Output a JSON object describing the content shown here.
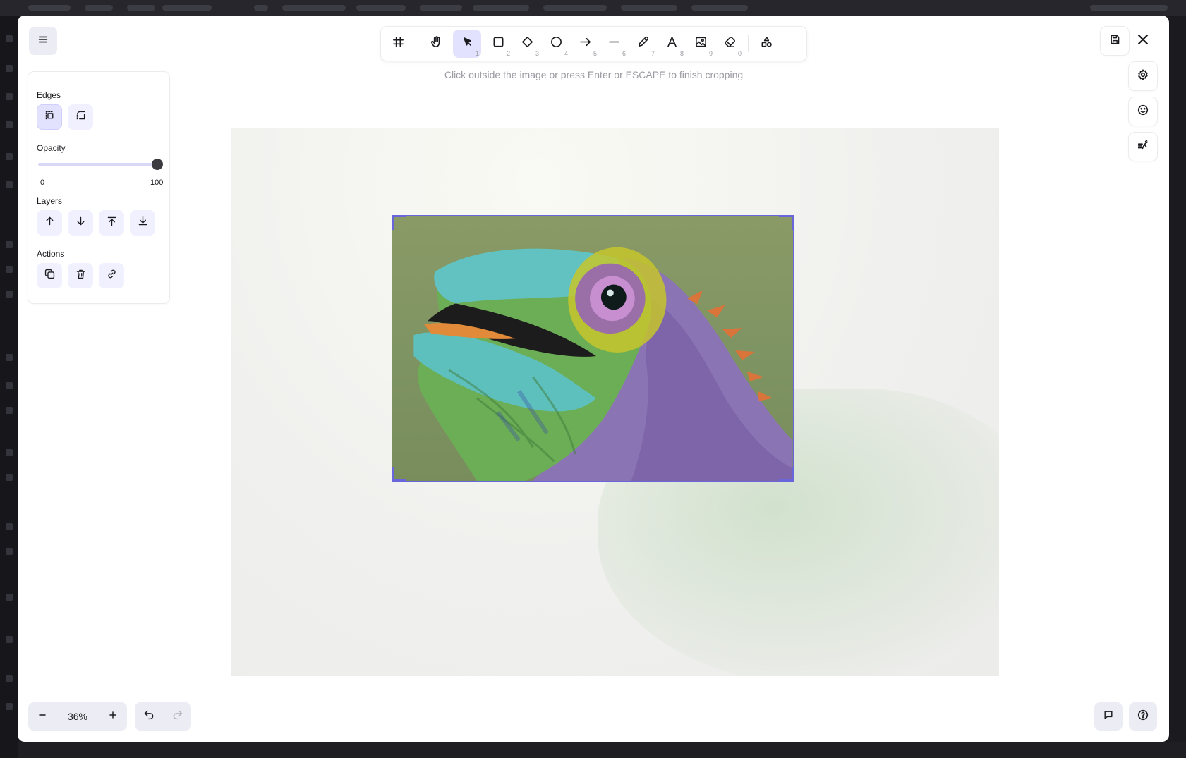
{
  "toolbar": {
    "tools": [
      {
        "name": "crop-tool",
        "key": ""
      },
      {
        "name": "hand-tool",
        "key": ""
      },
      {
        "name": "selection-tool",
        "key": "1",
        "active": true
      },
      {
        "name": "rectangle-tool",
        "key": "2"
      },
      {
        "name": "diamond-tool",
        "key": "3"
      },
      {
        "name": "ellipse-tool",
        "key": "4"
      },
      {
        "name": "arrow-tool",
        "key": "5"
      },
      {
        "name": "line-tool",
        "key": "6"
      },
      {
        "name": "draw-tool",
        "key": "7"
      },
      {
        "name": "text-tool",
        "key": "8"
      },
      {
        "name": "image-tool",
        "key": "9"
      },
      {
        "name": "eraser-tool",
        "key": "0"
      },
      {
        "name": "more-shapes-tool",
        "key": ""
      }
    ]
  },
  "hint": "Click outside the image or press Enter or ESCAPE to finish cropping",
  "panel": {
    "edges_label": "Edges",
    "opacity_label": "Opacity",
    "opacity_min": "0",
    "opacity_max": "100",
    "opacity_value": 100,
    "layers_label": "Layers",
    "actions_label": "Actions"
  },
  "zoom": {
    "value": "36%"
  },
  "accent_color": "#6965db",
  "icons": {
    "menu": "hamburger-icon",
    "save": "save-icon",
    "close": "close-icon",
    "settings": "gear-icon",
    "emoji": "smiley-icon",
    "sketch": "sketch-icon",
    "chat": "chat-icon",
    "help": "help-icon"
  }
}
